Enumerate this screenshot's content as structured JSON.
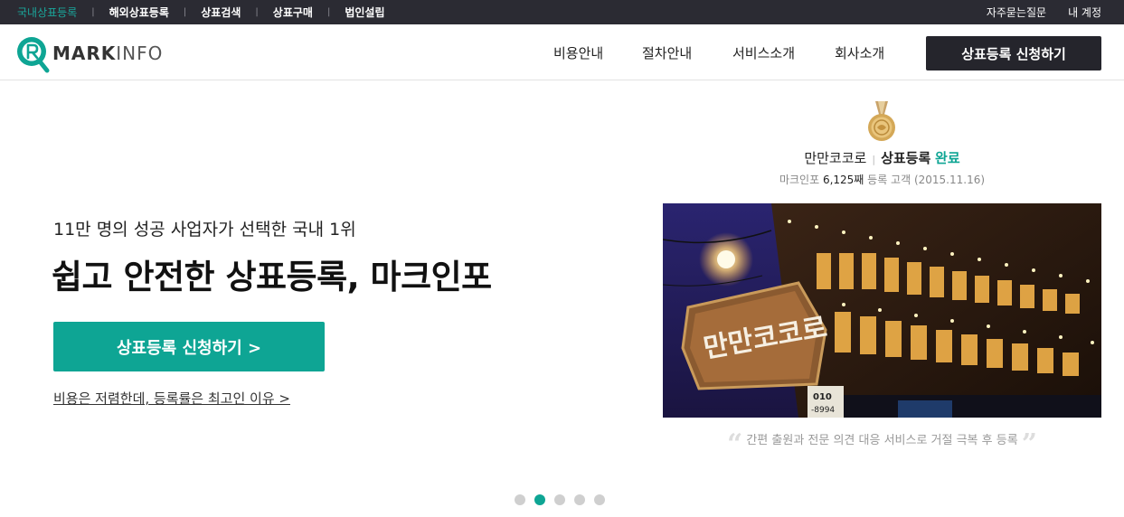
{
  "topbar": {
    "left": [
      "국내상표등록",
      "해외상표등록",
      "상표검색",
      "상표구매",
      "법인설립"
    ],
    "right": [
      "자주묻는질문",
      "내 계정"
    ],
    "active_index": 0
  },
  "logo": {
    "text_bold": "MARK",
    "text_light": "INFO",
    "icon": "r-magnifier-logo-icon"
  },
  "nav": {
    "items": [
      "비용안내",
      "절차안내",
      "서비스소개",
      "회사소개"
    ],
    "cta": "상표등록 신청하기"
  },
  "hero": {
    "subtitle": "11만 명의 성공 사업자가 선택한 국내 1위",
    "title": "쉽고 안전한 상표등록, 마크인포",
    "button": "상표등록 신청하기 >",
    "link": "비용은 저렴한데, 등록률은 최고인 이유 >"
  },
  "case": {
    "brand": "만만코코로",
    "label": "상표등록",
    "status": "완료",
    "sub_prefix": "마크인포 ",
    "sub_count": "6,125째",
    "sub_suffix": " 등록 고객 (2015.11.16)",
    "sign_text": "만만코코로",
    "phone_text": "010",
    "phone_text2": "-8994",
    "quote": "간편 출원과 전문 의견 대응 서비스로 거절 극복 후 등록"
  },
  "pager": {
    "count": 5,
    "active": 1
  },
  "colors": {
    "accent": "#0ea594",
    "topbar_bg": "#2b2b33",
    "cta_dark": "#25252c"
  }
}
